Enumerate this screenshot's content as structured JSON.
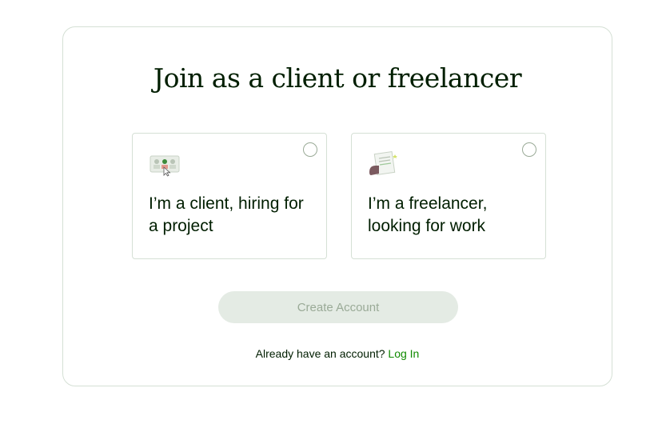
{
  "heading": "Join as a client or freelancer",
  "options": [
    {
      "id": "client",
      "label": "I’m a client, hiring for a project",
      "icon": "client-hiring-illustration",
      "selected": false
    },
    {
      "id": "freelancer",
      "label": "I’m a freelancer, looking for work",
      "icon": "freelancer-work-illustration",
      "selected": false
    }
  ],
  "create_button": {
    "label": "Create Account",
    "enabled": false
  },
  "login": {
    "prompt": "Already have an account?",
    "link_label": "Log In"
  },
  "colors": {
    "text": "#001e00",
    "link": "#108a00",
    "border": "#d5e0d5",
    "button_disabled_bg": "#e4ebe4",
    "button_disabled_text": "#9aaa97"
  }
}
